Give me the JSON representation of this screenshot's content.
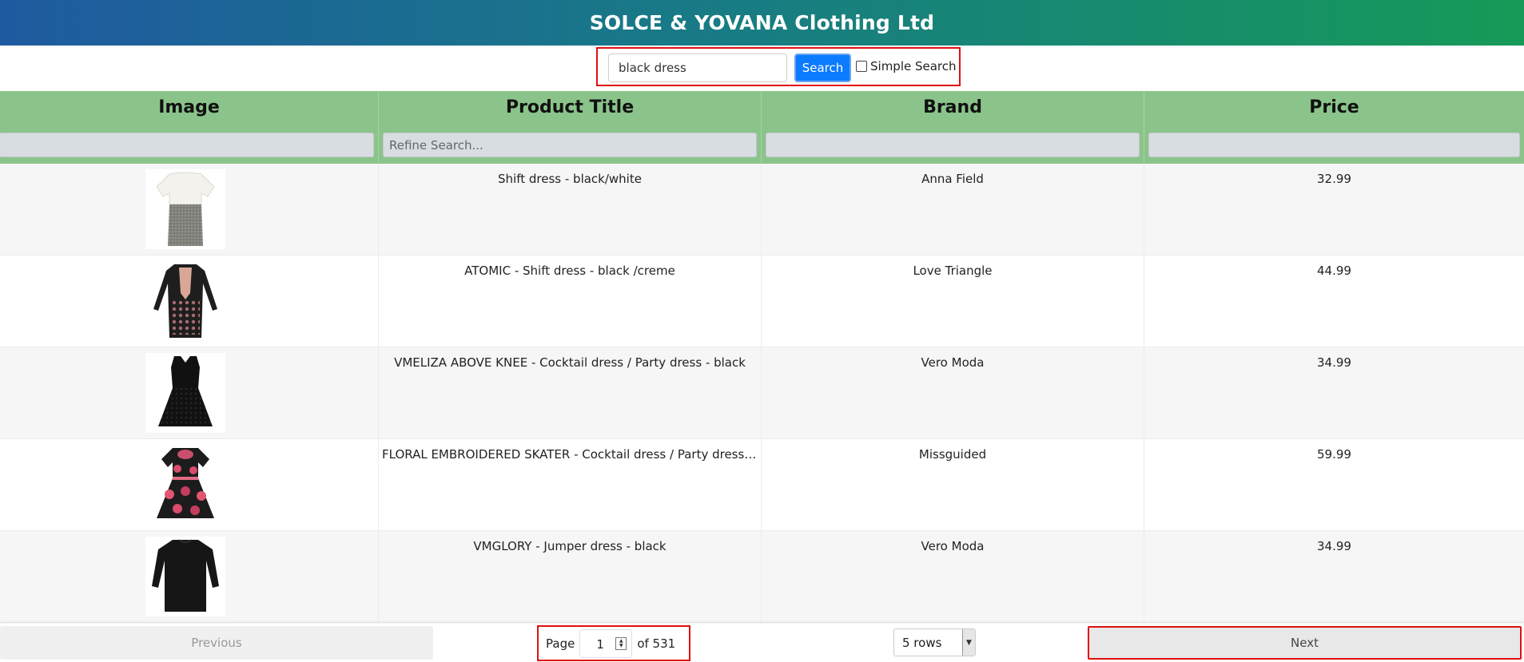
{
  "header": {
    "title": "SOLCE & YOVANA Clothing Ltd"
  },
  "search": {
    "value": "black dress",
    "button_label": "Search",
    "simple_label": "Simple Search",
    "simple_checked": false
  },
  "table": {
    "columns": [
      "Image",
      "Product Title",
      "Brand",
      "Price"
    ],
    "filters": {
      "image": "",
      "title_placeholder": "Refine Search...",
      "brand": "",
      "price": ""
    },
    "rows": [
      {
        "image": "white-top-grey-skirt-dress",
        "title": "Shift dress - black/white",
        "brand": "Anna Field",
        "price": "32.99"
      },
      {
        "image": "black-lace-long-sleeve-dress",
        "title": "ATOMIC - Shift dress - black /creme",
        "brand": "Love Triangle",
        "price": "44.99"
      },
      {
        "image": "black-sleeveless-lace-dress",
        "title": "VMELIZA ABOVE KNEE - Cocktail dress / Party dress - black",
        "brand": "Vero Moda",
        "price": "34.99"
      },
      {
        "image": "black-floral-embroidered-skater-dress",
        "title": "FLORAL EMBROIDERED SKATER - Cocktail dress / Party dress - bl...",
        "brand": "Missguided",
        "price": "59.99"
      },
      {
        "image": "black-jumper-dress",
        "title": "VMGLORY - Jumper dress - black",
        "brand": "Vero Moda",
        "price": "34.99"
      }
    ]
  },
  "pagination": {
    "previous_label": "Previous",
    "page_label": "Page",
    "page_value": "1",
    "of_label": "of 531",
    "rows_label": "5 rows",
    "next_label": "Next"
  }
}
